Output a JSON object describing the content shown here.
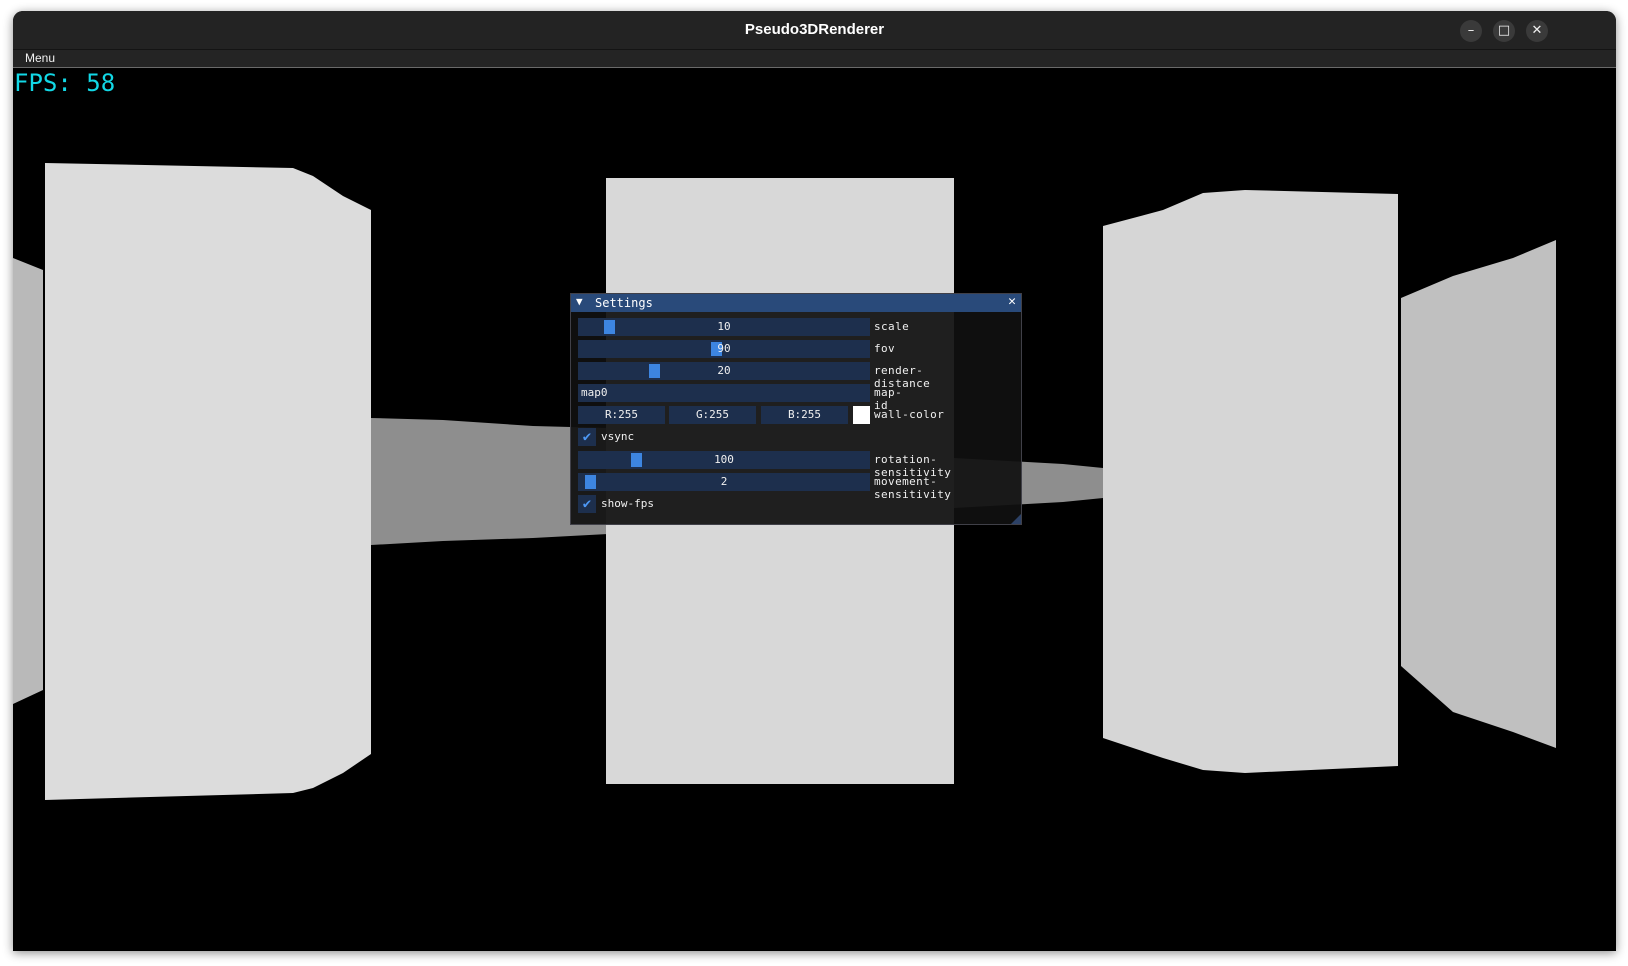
{
  "window": {
    "title": "Pseudo3DRenderer",
    "controls": [
      "minimize-icon",
      "maximize-icon",
      "close-icon"
    ]
  },
  "menubar": {
    "items": [
      {
        "label": "Menu"
      }
    ]
  },
  "overlay": {
    "fps_text": "FPS: 58"
  },
  "settings": {
    "title": "Settings",
    "scale": {
      "value": "10",
      "label": "scale"
    },
    "fov": {
      "value": "90",
      "label": "fov"
    },
    "render_distance": {
      "value": "20",
      "label": "render-distance"
    },
    "map_id": {
      "value": "map0",
      "label": "map-id"
    },
    "wall_color": {
      "r": "R:255",
      "g": "G:255",
      "b": "B:255",
      "label": "wall-color",
      "swatch": "#ffffff"
    },
    "vsync": {
      "label": "vsync",
      "checked": true
    },
    "rotation_sensitivity": {
      "value": "100",
      "label": "rotation-sensitivity"
    },
    "movement_sensitivity": {
      "value": "2",
      "label": "movement-sensitivity"
    },
    "show_fps": {
      "label": "show-fps",
      "checked": true
    }
  },
  "colors": {
    "fps_text": "#12d8e6",
    "panel_header": "#294a7a",
    "frame_bg": "#1d2f4d",
    "slider_grab": "#3d85e0",
    "checkmark": "#4d98f5",
    "wall_near": "#dcdcdc",
    "wall_far": "#8c8c8c"
  }
}
